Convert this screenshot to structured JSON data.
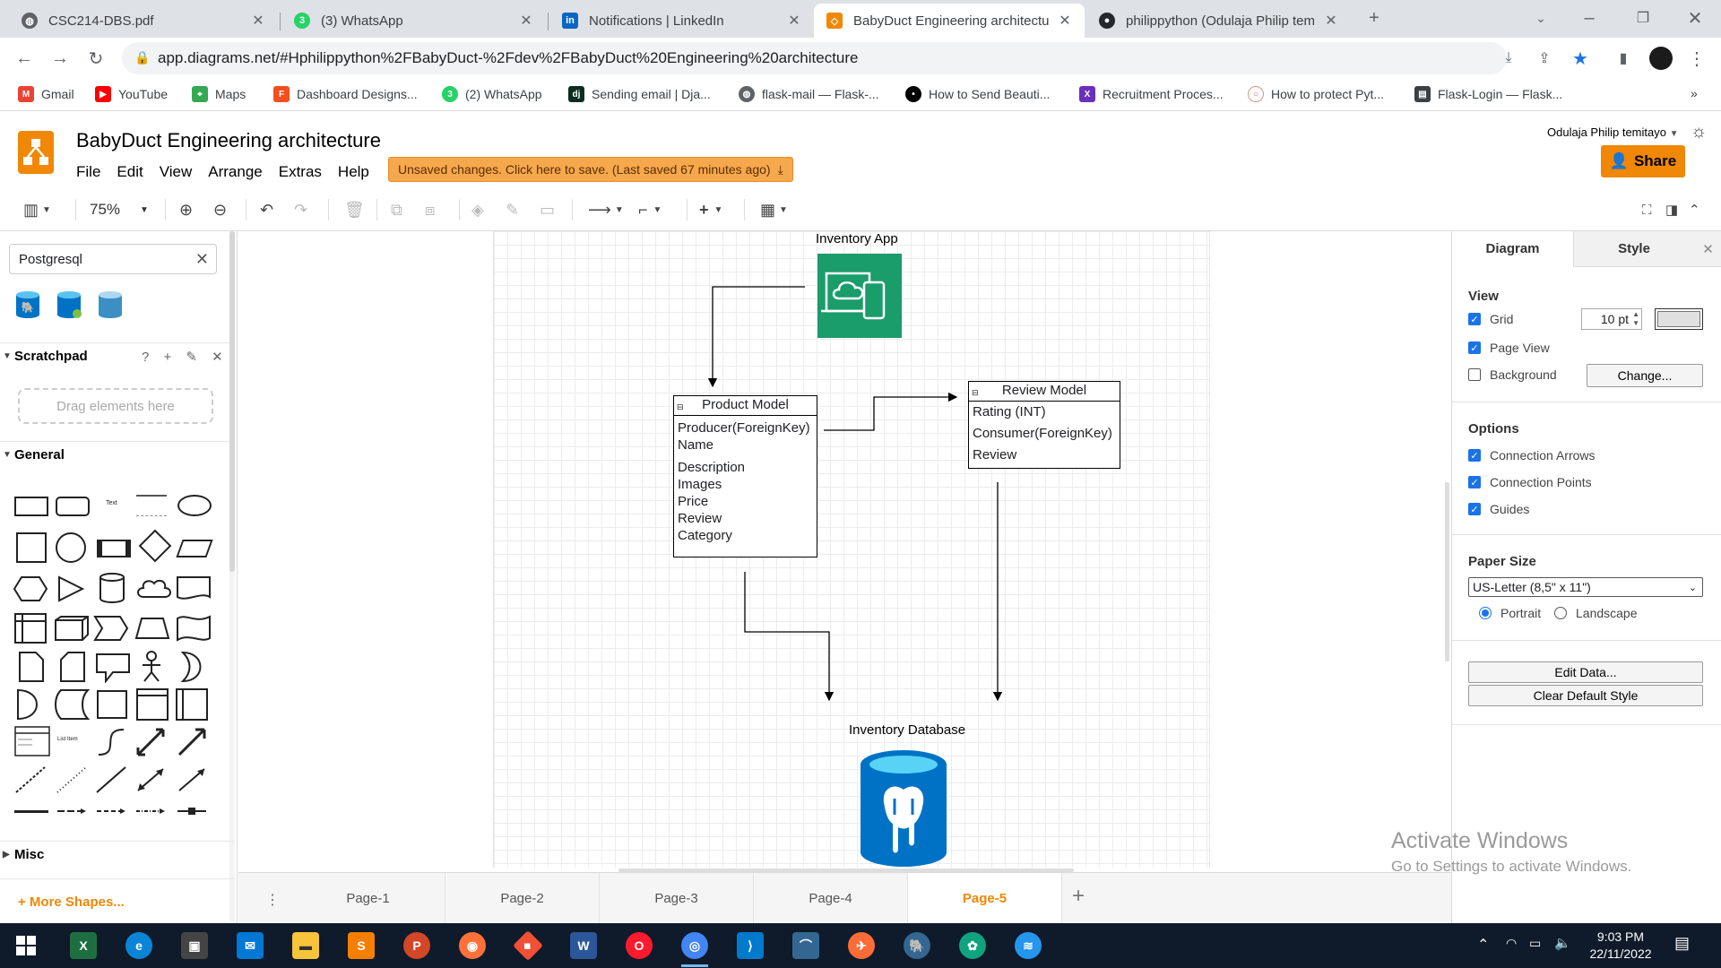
{
  "browser": {
    "tabs": [
      {
        "title": "CSC214-DBS.pdf",
        "icon": "globe-icon",
        "active": false
      },
      {
        "title": "(3) WhatsApp",
        "icon": "whatsapp-icon",
        "active": false
      },
      {
        "title": "Notifications | LinkedIn",
        "icon": "linkedin-icon",
        "active": false
      },
      {
        "title": "BabyDuct Engineering architectu",
        "icon": "drawio-icon",
        "active": true
      },
      {
        "title": "philippython (Odulaja Philip tem",
        "icon": "github-icon",
        "active": false
      }
    ],
    "url": "app.diagrams.net/#Hphilippython%2FBabyDuct-%2Fdev%2FBabyDuct%20Engineering%20architecture",
    "bookmarks": [
      "Gmail",
      "YouTube",
      "Maps",
      "Dashboard Designs...",
      "(2) WhatsApp",
      "Sending email | Dja...",
      "flask-mail — Flask-...",
      "How to Send Beauti...",
      "Recruitment Proces...",
      "How to protect Pyt...",
      "Flask-Login — Flask..."
    ]
  },
  "app": {
    "title": "BabyDuct Engineering architecture",
    "menus": [
      "File",
      "Edit",
      "View",
      "Arrange",
      "Extras",
      "Help"
    ],
    "unsaved_notice": "Unsaved changes. Click here to save. (Last saved 67 minutes ago)",
    "user": "Odulaja Philip temitayo",
    "share_label": "Share",
    "zoom": "75%"
  },
  "sidebar": {
    "search_value": "Postgresql",
    "scratchpad_label": "Scratchpad",
    "scratchpad_tools": "? + ✎ ✕",
    "dropzone_text": "Drag elements here",
    "general_label": "General",
    "misc_label": "Misc",
    "more_shapes": "+ More Shapes..."
  },
  "diagram": {
    "app_label": "Inventory App",
    "product_model": {
      "title": "Product Model",
      "fields": [
        "Producer(ForeignKey)",
        "Name",
        "Description",
        "Images",
        "Price",
        "Review",
        "Category"
      ]
    },
    "review_model": {
      "title": "Review Model",
      "fields": [
        "Rating (INT)",
        "Consumer(ForeignKey)",
        "Review"
      ]
    },
    "db_label": "Inventory Database"
  },
  "format_panel": {
    "tabs": [
      "Diagram",
      "Style"
    ],
    "view_label": "View",
    "grid_label": "Grid",
    "grid_size": "10 pt",
    "page_view_label": "Page View",
    "background_label": "Background",
    "change_btn": "Change...",
    "options_label": "Options",
    "connection_arrows": "Connection Arrows",
    "connection_points": "Connection Points",
    "guides": "Guides",
    "paper_size_label": "Paper Size",
    "paper_size_value": "US-Letter (8,5\" x 11\")",
    "portrait": "Portrait",
    "landscape": "Landscape",
    "edit_data_btn": "Edit Data...",
    "clear_style_btn": "Clear Default Style"
  },
  "pages": [
    "Page-1",
    "Page-2",
    "Page-3",
    "Page-4",
    "Page-5"
  ],
  "active_page": "Page-5",
  "watermark": {
    "line1": "Activate Windows",
    "line2": "Go to Settings to activate Windows."
  },
  "taskbar": {
    "time": "9:03 PM",
    "date": "22/11/2022"
  },
  "colors": {
    "accent": "#f08705",
    "app_icon_bg": "#1a9c6b",
    "db_blue": "#0072c6"
  }
}
